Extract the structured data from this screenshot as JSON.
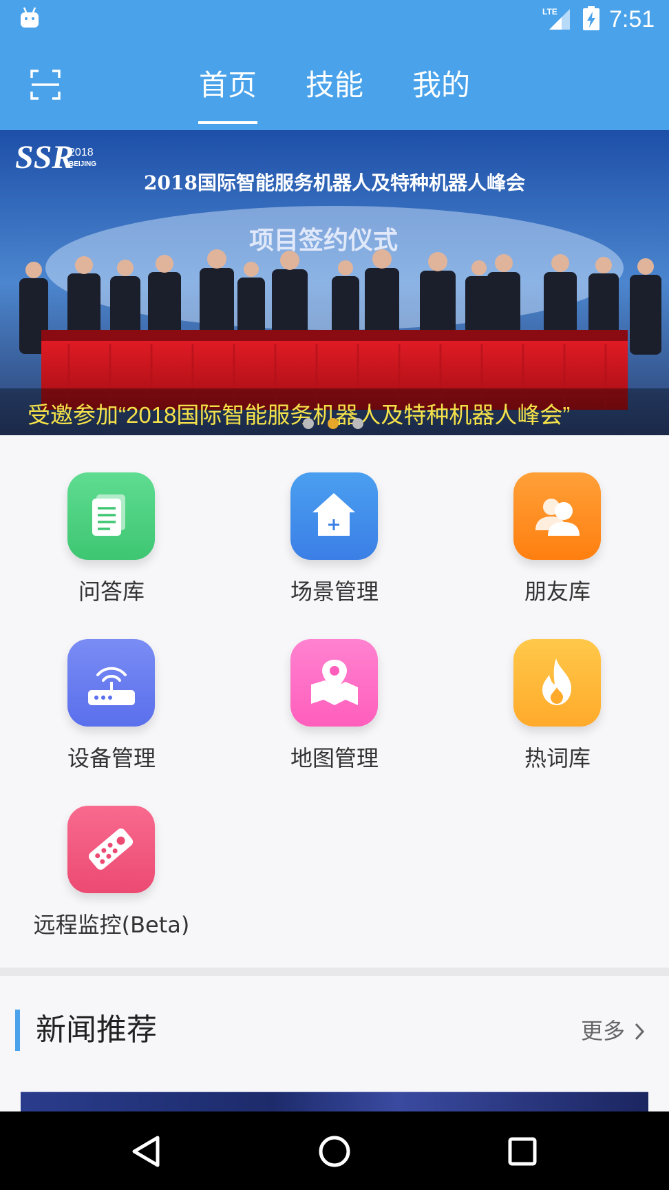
{
  "status_bar": {
    "network": "LTE",
    "time": "7:51"
  },
  "app_bar": {
    "tabs": [
      {
        "label": "首页",
        "active": true
      },
      {
        "label": "技能",
        "active": false
      },
      {
        "label": "我的",
        "active": false
      }
    ]
  },
  "banner": {
    "headline_in_image": "2018国际智能服务机器人及特种机器人峰会",
    "subheadline_in_image": "项目签约仪式",
    "logo_text": "SSR",
    "logo_year": "2018",
    "logo_city": "BEIJING",
    "caption": "受邀参加“2018国际智能服务机器人及特种机器人峰会”",
    "slide_count": 3,
    "active_slide": 2,
    "accent_color": "#e6a72b"
  },
  "grid": {
    "items": [
      {
        "label": "问答库",
        "icon": "document-icon",
        "color": "#4ccf80"
      },
      {
        "label": "场景管理",
        "icon": "home-add-icon",
        "color": "#3f8ee8"
      },
      {
        "label": "朋友库",
        "icon": "friends-icon",
        "color": "#ff8a1f"
      },
      {
        "label": "设备管理",
        "icon": "router-icon",
        "color": "#6a7ff0"
      },
      {
        "label": "地图管理",
        "icon": "map-pin-icon",
        "color": "#ff6fc6"
      },
      {
        "label": "热词库",
        "icon": "fire-icon",
        "color": "#ffbb3a"
      },
      {
        "label": "远程监控(Beta)",
        "icon": "remote-control-icon",
        "color": "#f0577c"
      }
    ]
  },
  "news": {
    "title": "新闻推荐",
    "more_label": "更多"
  },
  "theme": {
    "primary": "#4aa3ea"
  }
}
